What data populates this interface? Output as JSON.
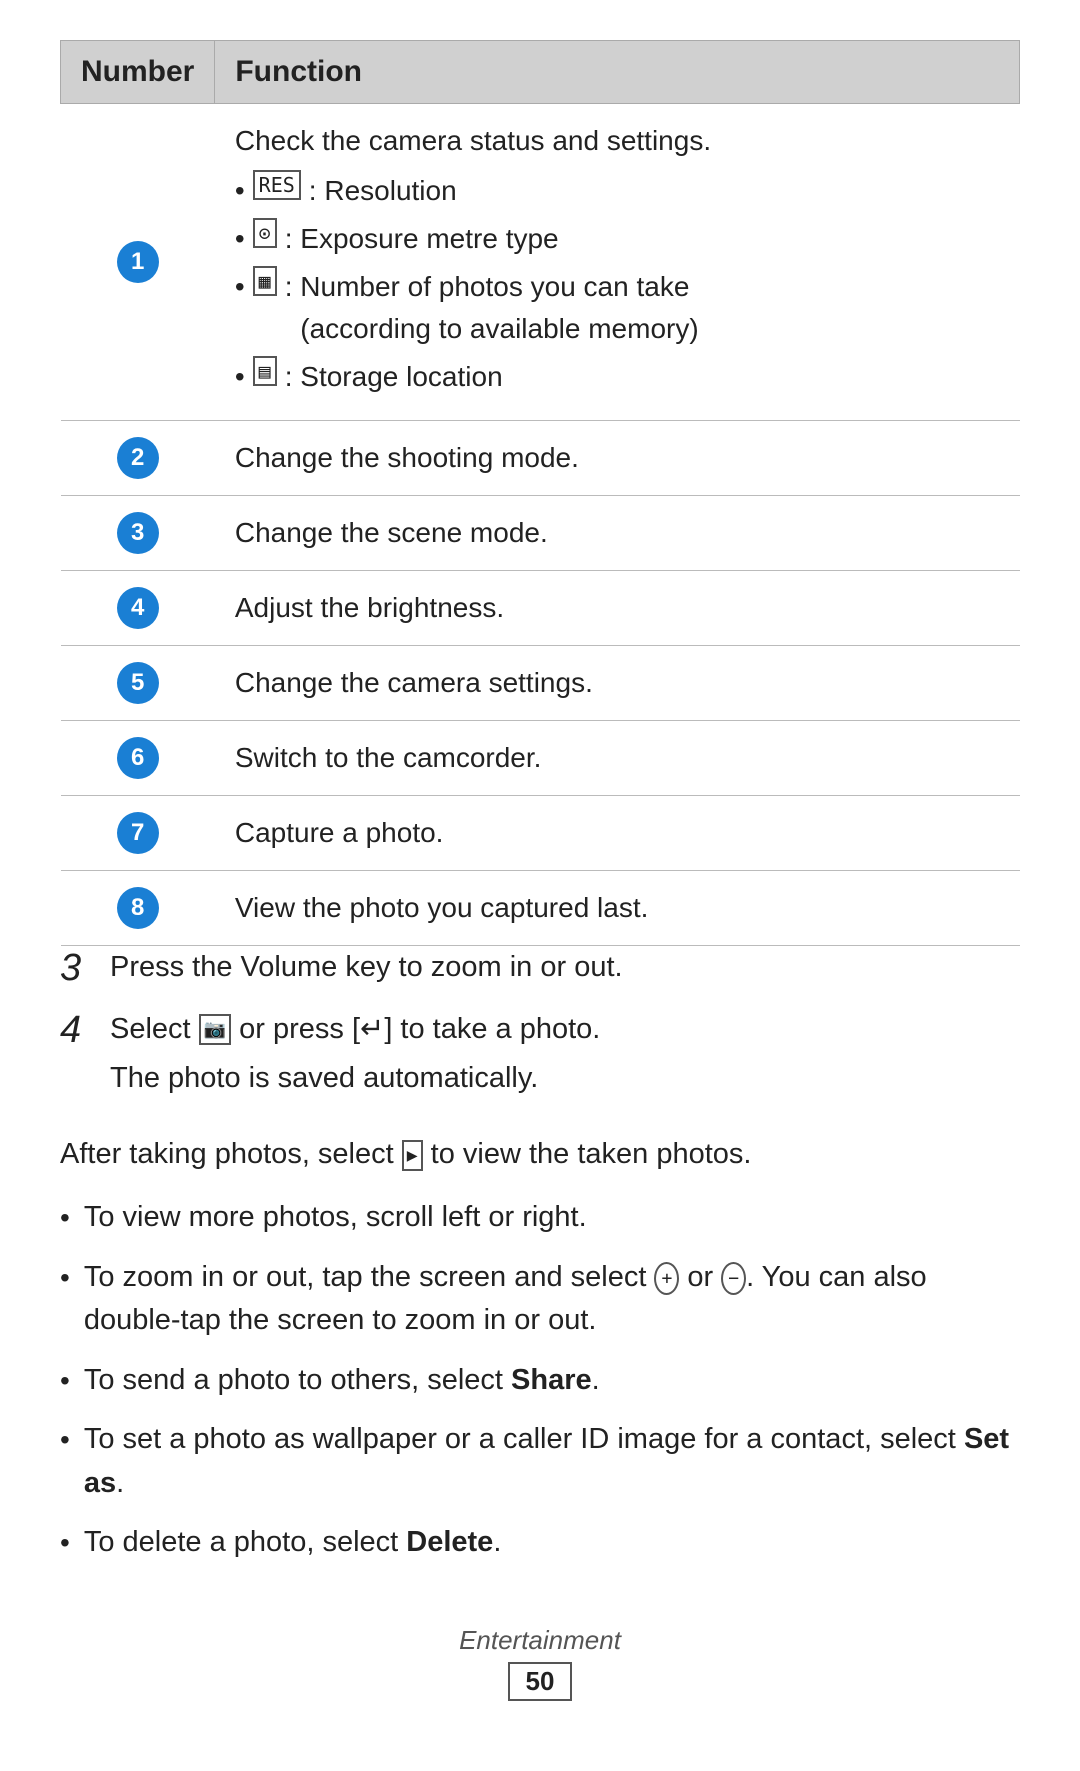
{
  "table": {
    "headers": [
      "Number",
      "Function"
    ],
    "rows": [
      {
        "num": "1",
        "function_main": "Check the camera status and settings.",
        "function_bullets": [
          {
            "icon": "RES",
            "text": ": Resolution"
          },
          {
            "icon": "⊙",
            "text": ": Exposure metre type"
          },
          {
            "icon": "▦",
            "text": ": Number of photos you can take (according to available memory)"
          },
          {
            "icon": "▤",
            "text": ": Storage location"
          }
        ]
      },
      {
        "num": "2",
        "function_main": "Change the shooting mode.",
        "function_bullets": []
      },
      {
        "num": "3",
        "function_main": "Change the scene mode.",
        "function_bullets": []
      },
      {
        "num": "4",
        "function_main": "Adjust the brightness.",
        "function_bullets": []
      },
      {
        "num": "5",
        "function_main": "Change the camera settings.",
        "function_bullets": []
      },
      {
        "num": "6",
        "function_main": "Switch to the camcorder.",
        "function_bullets": []
      },
      {
        "num": "7",
        "function_main": "Capture a photo.",
        "function_bullets": []
      },
      {
        "num": "8",
        "function_main": "View the photo you captured last.",
        "function_bullets": []
      }
    ]
  },
  "steps": [
    {
      "num": "3",
      "text": "Press the Volume key to zoom in or out."
    },
    {
      "num": "4",
      "text": "Select  or press [↵] to take a photo.",
      "sub": "The photo is saved automatically."
    }
  ],
  "after_text": "After taking photos, select ▶ to view the taken photos.",
  "bullets": [
    "To view more photos, scroll left or right.",
    "To zoom in or out, tap the screen and select ⊕ or ⊖. You can also double-tap the screen to zoom in or out.",
    "To send a photo to others, select Share.",
    "To set a photo as wallpaper or a caller ID image for a contact, select Set as.",
    "To delete a photo, select Delete."
  ],
  "bullets_bold": [
    {
      "pre": "To send a photo to others, select ",
      "bold": "Share",
      "post": "."
    },
    {
      "pre": "To set a photo as wallpaper or a caller ID image for a contact, select ",
      "bold": "Set as",
      "post": "."
    },
    {
      "pre": "To delete a photo, select ",
      "bold": "Delete",
      "post": "."
    }
  ],
  "footer": {
    "label": "Entertainment",
    "page": "50"
  }
}
